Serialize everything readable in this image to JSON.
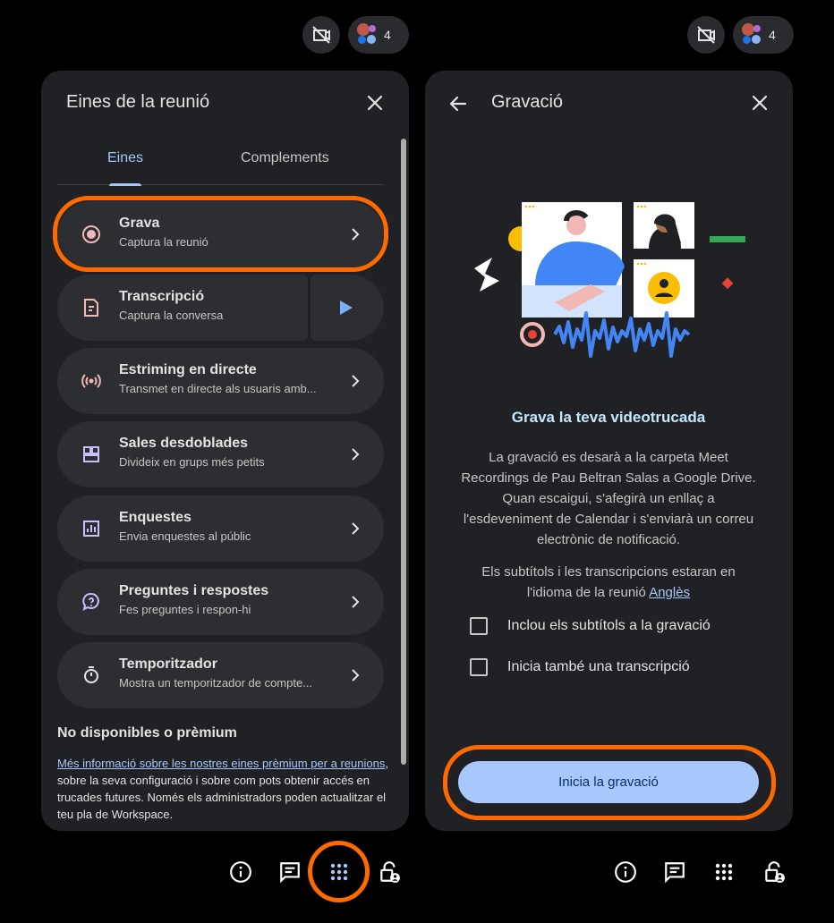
{
  "top_bar": {
    "participant_count": "4"
  },
  "left_panel": {
    "title": "Eines de la reunió",
    "tabs": [
      {
        "label": "Eines"
      },
      {
        "label": "Complements"
      }
    ],
    "tools": [
      {
        "title": "Grava",
        "subtitle": "Captura la reunió",
        "icon": "record-icon"
      },
      {
        "title": "Transcripció",
        "subtitle": "Captura la conversa",
        "icon": "transcript-icon"
      },
      {
        "title": "Estriming en directe",
        "subtitle": "Transmet en directe als usuaris amb...",
        "icon": "live-stream-icon"
      },
      {
        "title": "Sales desdoblades",
        "subtitle": "Divideix en grups més petits",
        "icon": "breakout-rooms-icon"
      },
      {
        "title": "Enquestes",
        "subtitle": "Envia enquestes al públic",
        "icon": "polls-icon"
      },
      {
        "title": "Preguntes i respostes",
        "subtitle": "Fes preguntes i respon-hi",
        "icon": "qa-icon"
      },
      {
        "title": "Temporitzador",
        "subtitle": "Mostra un temporitzador de compte...",
        "icon": "timer-icon"
      }
    ],
    "unavailable_heading": "No disponibles o prèmium",
    "unavailable_link": "Més informació sobre les nostres eines prèmium per a reunions",
    "unavailable_text": ", sobre la seva configuració i sobre com pots obtenir accés en trucades futures. Només els administradors poden actualitzar el teu pla de Workspace."
  },
  "right_panel": {
    "title": "Gravació",
    "heading": "Grava la teva videotrucada",
    "description": "La gravació es desarà a la carpeta Meet Recordings de Pau Beltran Salas a Google Drive. Quan escaigui, s'afegirà un enllaç a l'esdeveniment de Calendar i s'enviarà un correu electrònic de notificació.",
    "language_text": "Els subtítols i les transcripcions estaran en l'idioma de la reunió",
    "language_link": "Anglès",
    "checkbox_captions": "Inclou els subtítols a la gravació",
    "checkbox_transcript": "Inicia també una transcripció",
    "start_button": "Inicia la gravació"
  },
  "colors": {
    "background": "#000000",
    "panel": "#202124",
    "card": "#2d2e31",
    "accent": "#a8c7fa",
    "highlight": "#ff6a00",
    "record_icon": "#f2b8b5"
  }
}
